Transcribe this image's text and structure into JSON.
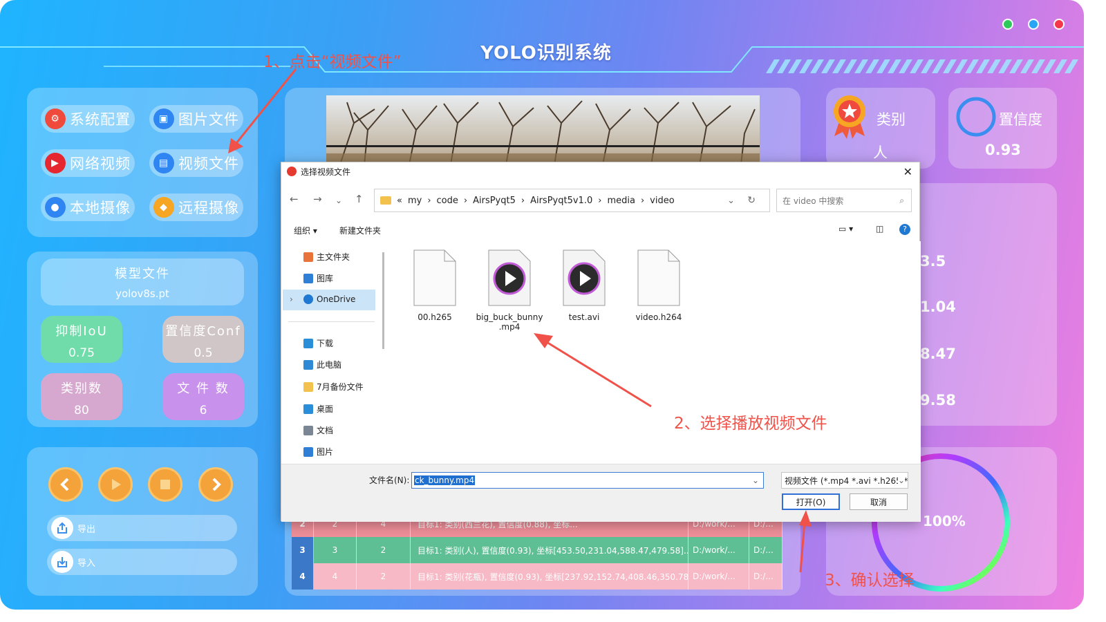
{
  "app": {
    "title": "YOLO识别系统",
    "window_buttons": [
      {
        "icon": "minimize-icon",
        "color": "#2ec95c"
      },
      {
        "icon": "maximize-icon",
        "color": "#2aa4f4"
      },
      {
        "icon": "close-icon",
        "color": "#f2384a"
      }
    ]
  },
  "menu": {
    "items": [
      {
        "label": "系统配置",
        "icon": "gear-icon",
        "color": "#f04a3d"
      },
      {
        "label": "图片文件",
        "icon": "image-icon",
        "color": "#2f86f2"
      },
      {
        "label": "网络视频",
        "icon": "youtube-icon",
        "color": "#e7272f"
      },
      {
        "label": "视频文件",
        "icon": "film-icon",
        "color": "#2f86f2"
      },
      {
        "label": "本地摄像",
        "icon": "camera-icon",
        "color": "#2f86f2"
      },
      {
        "label": "远程摄像",
        "icon": "remote-camera-icon",
        "color": "#f6a623"
      }
    ]
  },
  "model": {
    "title": "模型文件",
    "file": "yolov8s.pt",
    "iou_label": "抑制IoU",
    "iou_value": "0.75",
    "conf_label": "置信度Conf",
    "conf_value": "0.5",
    "classes_label": "类别数",
    "classes_value": "80",
    "files_label": "文 件 数",
    "files_value": "6"
  },
  "controls": {
    "export_label": "导出",
    "import_label": "导入"
  },
  "stats": {
    "class_label": "类别",
    "class_value": "人",
    "conf_label": "置信度",
    "conf_value": "0.93",
    "coords": [
      "3.5",
      "1.04",
      "8.47",
      "9.58"
    ],
    "progress": "100%",
    "progress_fraction": 1.0
  },
  "table": {
    "rows": [
      {
        "idx": "2",
        "no": "2",
        "count": "4",
        "info": "目标1: 类别(西兰花), 置信度(0.88), 坐标...",
        "path": "D:/work/...",
        "path2": "D:/...",
        "color": "#ef8f9a"
      },
      {
        "idx": "3",
        "no": "3",
        "count": "2",
        "info": "目标1: 类别(人), 置信度(0.93), 坐标[453.50,231.04,588.47,479.58]...",
        "path": "D:/work/...",
        "path2": "D:/...",
        "color": "#5fbf94"
      },
      {
        "idx": "4",
        "no": "4",
        "count": "2",
        "info": "目标1: 类别(花瓶), 置信度(0.93), 坐标[237.92,152.74,408.46,350.78...",
        "path": "D:/work/...",
        "path2": "D:/...",
        "color": "#f6b9c5"
      }
    ]
  },
  "dialog": {
    "title": "选择视频文件",
    "breadcrumb": [
      "«",
      "my",
      "›",
      "code",
      "›",
      "AirsPyqt5",
      "›",
      "AirsPyqt5v1.0",
      "›",
      "media",
      "›",
      "video"
    ],
    "search_placeholder": "在 video 中搜索",
    "organize": "组织 ▾",
    "new_folder": "新建文件夹",
    "sidebar": [
      {
        "label": "主文件夹",
        "icon": "home-icon",
        "color": "#e8743b"
      },
      {
        "label": "图库",
        "icon": "gallery-icon",
        "color": "#2f7fd6"
      },
      {
        "label": "OneDrive",
        "icon": "cloud-icon",
        "color": "#1f78d1"
      },
      {
        "label": "下载",
        "icon": "download-icon",
        "color": "#2a8ed8"
      },
      {
        "label": "此电脑",
        "icon": "pc-icon",
        "color": "#2f8ad6"
      },
      {
        "label": "7月备份文件",
        "icon": "folder-icon",
        "color": "#f2c14e"
      },
      {
        "label": "桌面",
        "icon": "desktop-icon",
        "color": "#2a8ed8"
      },
      {
        "label": "文档",
        "icon": "document-icon",
        "color": "#7a8694"
      },
      {
        "label": "图片",
        "icon": "picture-icon",
        "color": "#2f7fd6"
      }
    ],
    "files": [
      {
        "name": "00.h265",
        "type": "doc"
      },
      {
        "name": "big_buck_bunny\n.mp4",
        "type": "video"
      },
      {
        "name": "test.avi",
        "type": "video"
      },
      {
        "name": "video.h264",
        "type": "doc"
      }
    ],
    "filename_label": "文件名(N):",
    "filename_value": "ck_bunny.mp4",
    "filter": "视频文件 (*.mp4 *.avi *.h265 *",
    "open_button": "打开(O)",
    "cancel_button": "取消"
  },
  "annotations": {
    "step1": "1、点击“视频文件”",
    "step2": "2、选择播放视频文件",
    "step3": "3、确认选择"
  }
}
